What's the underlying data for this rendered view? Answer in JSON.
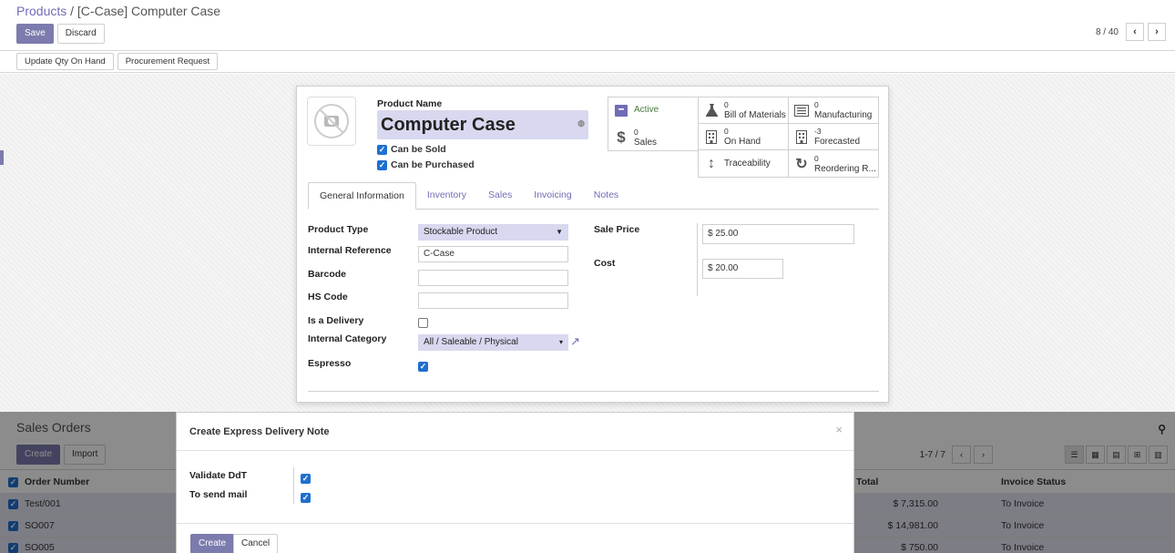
{
  "breadcrumb": {
    "parent": "Products",
    "separator": "/",
    "current": "[C-Case] Computer Case"
  },
  "control_panel": {
    "save_label": "Save",
    "discard_label": "Discard",
    "pager": "8 / 40"
  },
  "statusbar": {
    "update_qty_label": "Update Qty On Hand",
    "procurement_label": "Procurement Request"
  },
  "product": {
    "name_label": "Product Name",
    "name": "Computer Case",
    "can_be_sold_label": "Can be Sold",
    "can_be_sold": true,
    "can_be_purchased_label": "Can be Purchased",
    "can_be_purchased": true
  },
  "smart_buttons": {
    "active": {
      "label": "Active",
      "icon": "archive-icon"
    },
    "bom": {
      "count": "0",
      "label": "Bill of Materials",
      "icon": "flask-icon"
    },
    "manufacturing": {
      "count": "0",
      "label": "Manufacturing",
      "icon": "list-icon"
    },
    "sales": {
      "count": "0",
      "label": "Sales",
      "icon": "dollar-icon"
    },
    "on_hand": {
      "count": "0",
      "label": "On Hand",
      "icon": "building-icon"
    },
    "forecasted": {
      "count": "-3",
      "label": "Forecasted",
      "icon": "building-icon"
    },
    "traceability": {
      "label": "Traceability",
      "icon": "arrows-vertical-icon"
    },
    "reordering": {
      "count": "0",
      "label": "Reordering R...",
      "icon": "refresh-icon"
    }
  },
  "tabs": [
    "General Information",
    "Inventory",
    "Sales",
    "Invoicing",
    "Notes"
  ],
  "general": {
    "product_type_label": "Product Type",
    "product_type": "Stockable Product",
    "internal_ref_label": "Internal Reference",
    "internal_ref": "C-Case",
    "barcode_label": "Barcode",
    "barcode": "",
    "hs_code_label": "HS Code",
    "hs_code": "",
    "is_delivery_label": "Is a Delivery",
    "is_delivery": false,
    "internal_category_label": "Internal Category",
    "internal_category": "All / Saleable / Physical",
    "espresso_label": "Espresso",
    "espresso": true,
    "sale_price_label": "Sale Price",
    "sale_price": "$ 25.00",
    "cost_label": "Cost",
    "cost": "$ 20.00"
  },
  "sales_orders": {
    "title": "Sales Orders",
    "create_label": "Create",
    "import_label": "Import",
    "pager": "1-7 / 7",
    "columns": {
      "order_number": "Order Number",
      "total": "Total",
      "invoice_status": "Invoice Status"
    },
    "rows": [
      {
        "order": "Test/001",
        "total": "$ 7,315.00",
        "status": "To Invoice"
      },
      {
        "order": "SO007",
        "total": "$ 14,981.00",
        "status": "To Invoice"
      },
      {
        "order": "SO005",
        "total": "$ 750.00",
        "status": "To Invoice"
      }
    ]
  },
  "modal": {
    "title": "Create Express Delivery Note",
    "close": "×",
    "validate_ddt_label": "Validate DdT",
    "validate_ddt": true,
    "to_send_mail_label": "To send mail",
    "to_send_mail": true,
    "create_label": "Create",
    "cancel_label": "Cancel"
  },
  "colors": {
    "primary": "#7c7bad",
    "link": "#6f6db5",
    "checkbox": "#1f6fcf",
    "field_required": "#d8d8f0"
  }
}
